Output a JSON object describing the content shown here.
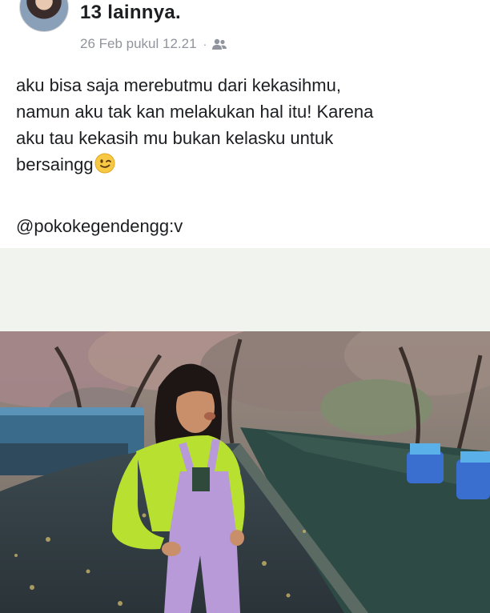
{
  "post": {
    "author_line": "13 lainnya.",
    "timestamp": "26 Feb pukul 12.21",
    "separator": "·",
    "audience_icon": "friends-icon",
    "text": "aku bisa saja merebutmu dari kekasihmu,\nnamun aku tak kan melakukan hal itu! Karena\naku tau kekasih mu bukan kelasku untuk\nbersaingg",
    "emoji": "winking-face-emoji",
    "mention": "@pokokegendengg:v"
  },
  "colors": {
    "text": "#1c1e21",
    "meta": "#90949c",
    "band": "#f0f3ee",
    "shirt": "#b8e030",
    "overalls": "#b89ad8"
  }
}
